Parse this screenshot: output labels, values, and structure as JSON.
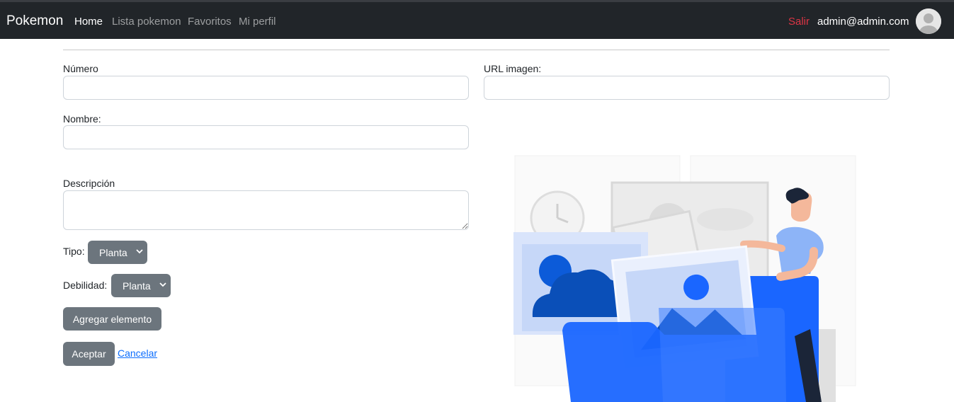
{
  "navbar": {
    "brand": "Pokemon",
    "links": [
      {
        "label": "Home",
        "active": true
      },
      {
        "label": "Lista pokemon",
        "active": false
      },
      {
        "label": "Favoritos",
        "active": false
      },
      {
        "label": "Mi perfil",
        "active": false
      }
    ],
    "logout": "Salir",
    "user_email": "admin@admin.com",
    "avatar_icon": "user-avatar-icon"
  },
  "form": {
    "numero_label": "Número",
    "numero_value": "",
    "url_label": "URL imagen:",
    "url_value": "",
    "nombre_label": "Nombre:",
    "nombre_value": "",
    "descripcion_label": "Descripción",
    "descripcion_value": "",
    "tipo_label": "Tipo:",
    "tipo_value": "Planta",
    "debilidad_label": "Debilidad:",
    "debilidad_value": "Planta",
    "add_button": "Agregar elemento",
    "accept_button": "Aceptar",
    "cancel_link": "Cancelar"
  },
  "colors": {
    "navbar_bg": "#212529",
    "logout": "#dc3545",
    "button_bg": "#6c757d",
    "link": "#0d6efd",
    "illustration_blue": "#1a66ff"
  }
}
